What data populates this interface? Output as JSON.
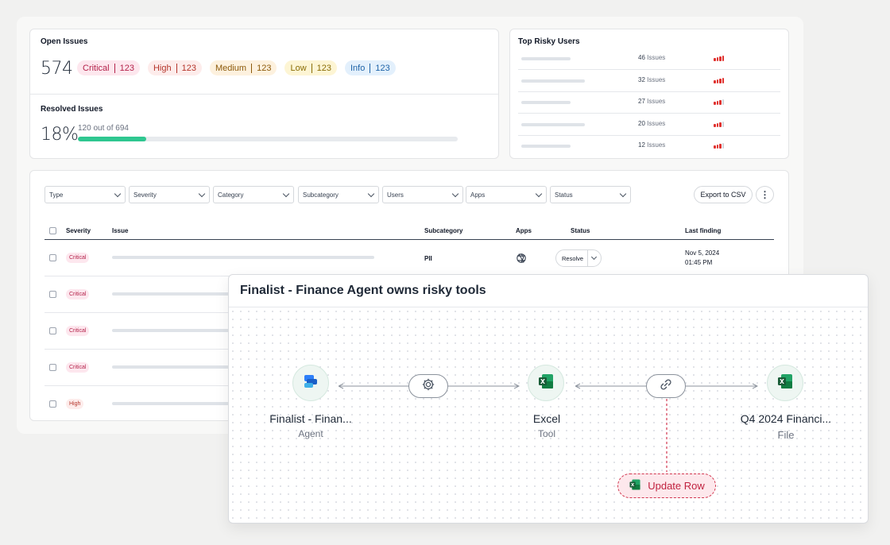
{
  "open_issues": {
    "title": "Open Issues",
    "total": "574",
    "severities": [
      {
        "label": "Critical",
        "count": "123"
      },
      {
        "label": "High",
        "count": "123"
      },
      {
        "label": "Medium",
        "count": "123"
      },
      {
        "label": "Low",
        "count": "123"
      },
      {
        "label": "Info",
        "count": "123"
      }
    ]
  },
  "resolved_issues": {
    "title": "Resolved Issues",
    "percent": "18%",
    "detail": "120 out of 694",
    "progress_fraction": 0.18
  },
  "top_risky_users": {
    "title": "Top Risky Users",
    "issues_word": "Issues",
    "rows": [
      {
        "count": "46",
        "risk_level": 4
      },
      {
        "count": "32",
        "risk_level": 4
      },
      {
        "count": "27",
        "risk_level": 3
      },
      {
        "count": "20",
        "risk_level": 3
      },
      {
        "count": "12",
        "risk_level": 3
      }
    ]
  },
  "filters": [
    "Type",
    "Severity",
    "Category",
    "Subcategory",
    "Users",
    "Apps",
    "Status"
  ],
  "toolbar": {
    "export_label": "Export to CSV",
    "more_label": "⋮"
  },
  "table": {
    "columns": {
      "severity": "Severity",
      "issue": "Issue",
      "subcategory": "Subcategory",
      "apps": "Apps",
      "status": "Status",
      "last_finding": "Last finding"
    },
    "rows": [
      {
        "severity": "Critical",
        "subcategory": "PII",
        "app_icon": "openai-icon",
        "status": "Resolve",
        "date": "Nov 5, 2024",
        "time": "01:45 PM"
      },
      {
        "severity": "Critical"
      },
      {
        "severity": "Critical"
      },
      {
        "severity": "Critical"
      },
      {
        "severity": "High"
      }
    ]
  },
  "overlay": {
    "title": "Finalist - Finance Agent owns risky tools",
    "nodes": [
      {
        "title": "Finalist - Finan...",
        "subtitle": "Agent",
        "icon": "copilot-icon"
      },
      {
        "title": "Excel",
        "subtitle": "Tool",
        "icon": "excel-icon"
      },
      {
        "title": "Q4 2024 Financi...",
        "subtitle": "File",
        "icon": "excel-icon"
      }
    ],
    "connectors": [
      "gear-icon",
      "link-icon"
    ],
    "action": {
      "label": "Update Row",
      "icon": "excel-icon"
    }
  },
  "colors": {
    "accent_green": "#2fc790",
    "critical": "#b4234b",
    "excel_green": "#1d7a44",
    "signal_red": "#e0322f",
    "update_red": "#c0223f"
  }
}
